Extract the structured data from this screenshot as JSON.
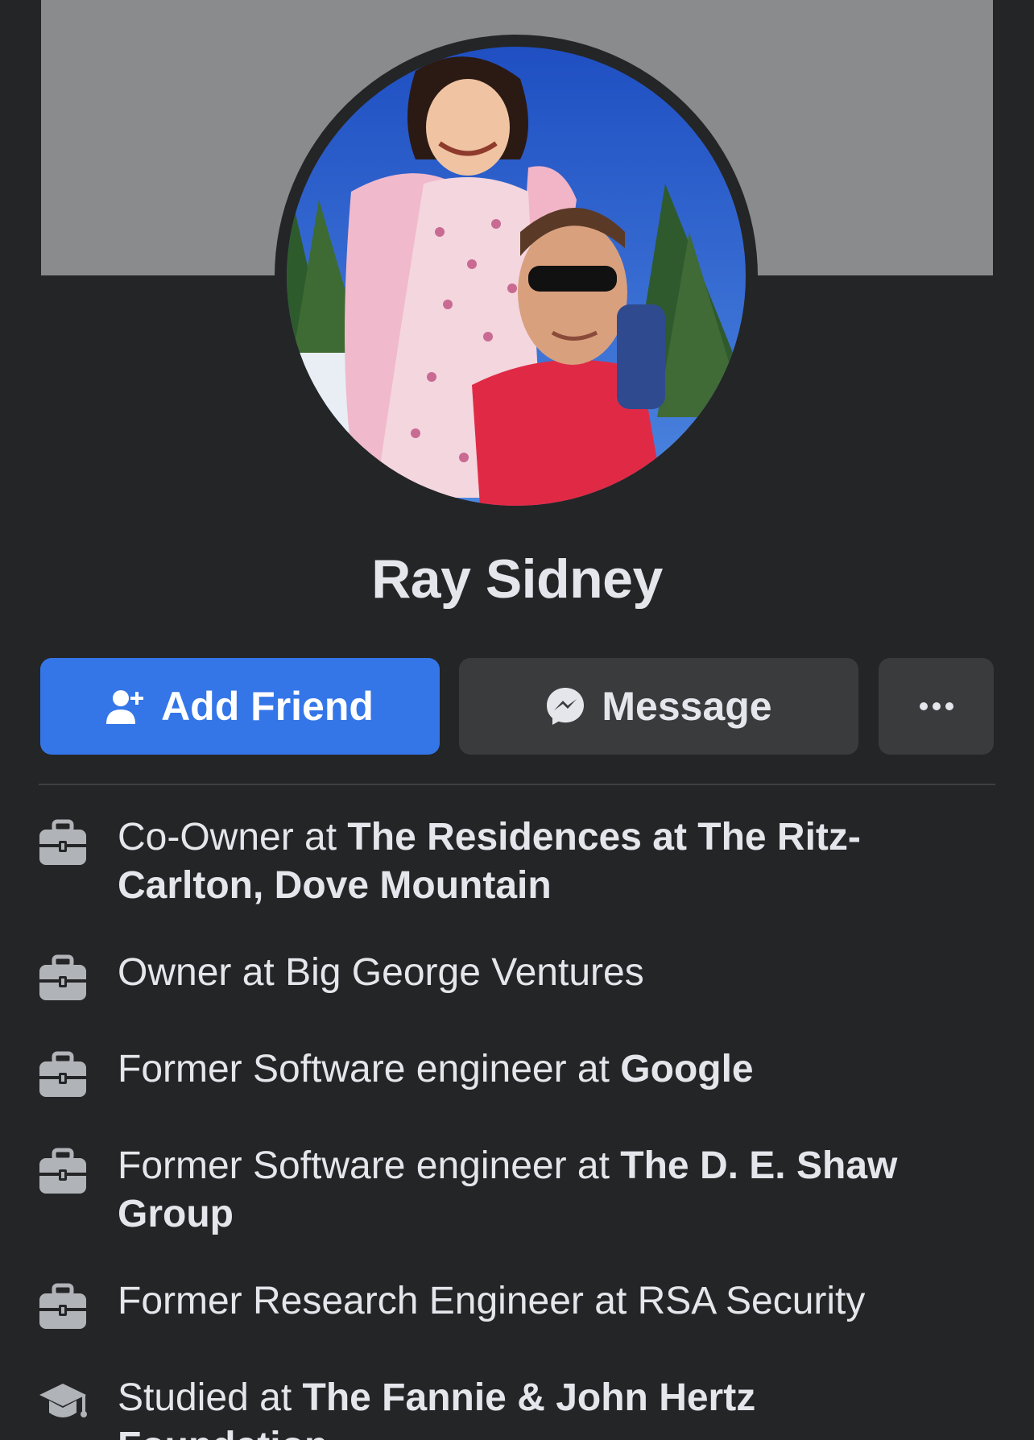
{
  "profile": {
    "name": "Ray Sidney"
  },
  "actions": {
    "add_friend_label": "Add Friend",
    "message_label": "Message",
    "more_label": "⋯"
  },
  "intro": [
    {
      "icon": "briefcase-icon",
      "prefix": "Co-Owner at ",
      "place": "The Residences at The Ritz-Carlton, Dove Mountain"
    },
    {
      "icon": "briefcase-icon",
      "prefix": "Owner at Big George Ventures",
      "place": ""
    },
    {
      "icon": "briefcase-icon",
      "prefix": "Former Software engineer at ",
      "place": "Google"
    },
    {
      "icon": "briefcase-icon",
      "prefix": "Former Software engineer at ",
      "place": "The D. E. Shaw Group"
    },
    {
      "icon": "briefcase-icon",
      "prefix": "Former Research Engineer at RSA Security",
      "place": ""
    },
    {
      "icon": "graduation-cap-icon",
      "prefix": "Studied at ",
      "place": "The Fannie & John Hertz Foundation"
    }
  ],
  "colors": {
    "background": "#242526",
    "cover": "#8a8b8d",
    "primary_button": "#3476e8",
    "secondary_button": "#3a3b3c"
  }
}
